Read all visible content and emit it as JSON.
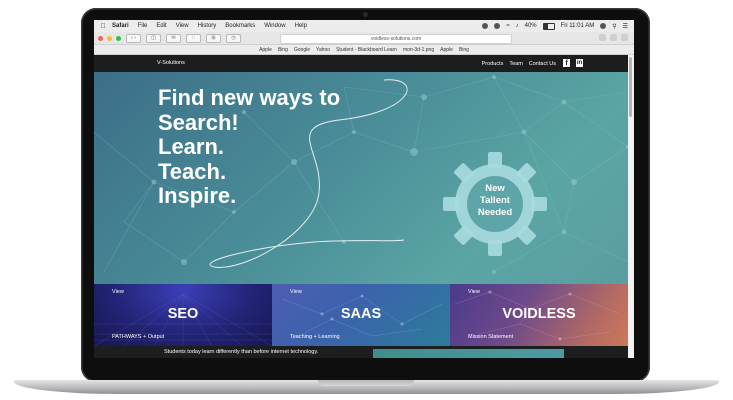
{
  "menubar": {
    "app_name": "Safari",
    "items": [
      "File",
      "Edit",
      "View",
      "History",
      "Bookmarks",
      "Window",
      "Help"
    ],
    "battery": "40%",
    "clock": "Fri 11:01 AM"
  },
  "browser": {
    "url": "voidless-solutions.com",
    "bookmarks": [
      "Apple",
      "Bing",
      "Google",
      "Yahoo",
      "Student - Blackboard Learn",
      "mon-3d-1.png",
      "Apple",
      "Bing"
    ]
  },
  "site": {
    "brand": "V-Solutions",
    "nav": {
      "products": "Products",
      "team": "Team",
      "contact": "Contact Us"
    },
    "hero": {
      "line1": "Find new ways to",
      "line2": "Search!",
      "line3": "Learn.",
      "line4": "Teach.",
      "line5": "Inspire."
    },
    "gear": {
      "line1": "New",
      "line2": "Tallent",
      "line3": "Needed"
    },
    "cards": [
      {
        "view": "View",
        "title": "SEO",
        "subtitle": "PATHWAYS + Output"
      },
      {
        "view": "View",
        "title": "SAAS",
        "subtitle": "Teaching + Learning"
      },
      {
        "view": "View",
        "title": "VOIDLESS",
        "subtitle": "Mission Statement"
      }
    ],
    "footer_text": "Students today learn differently than before internet technology."
  },
  "colors": {
    "hero_start": "#3c6f88",
    "hero_end": "#5ba5a4",
    "gear": "#a9dcdf"
  }
}
